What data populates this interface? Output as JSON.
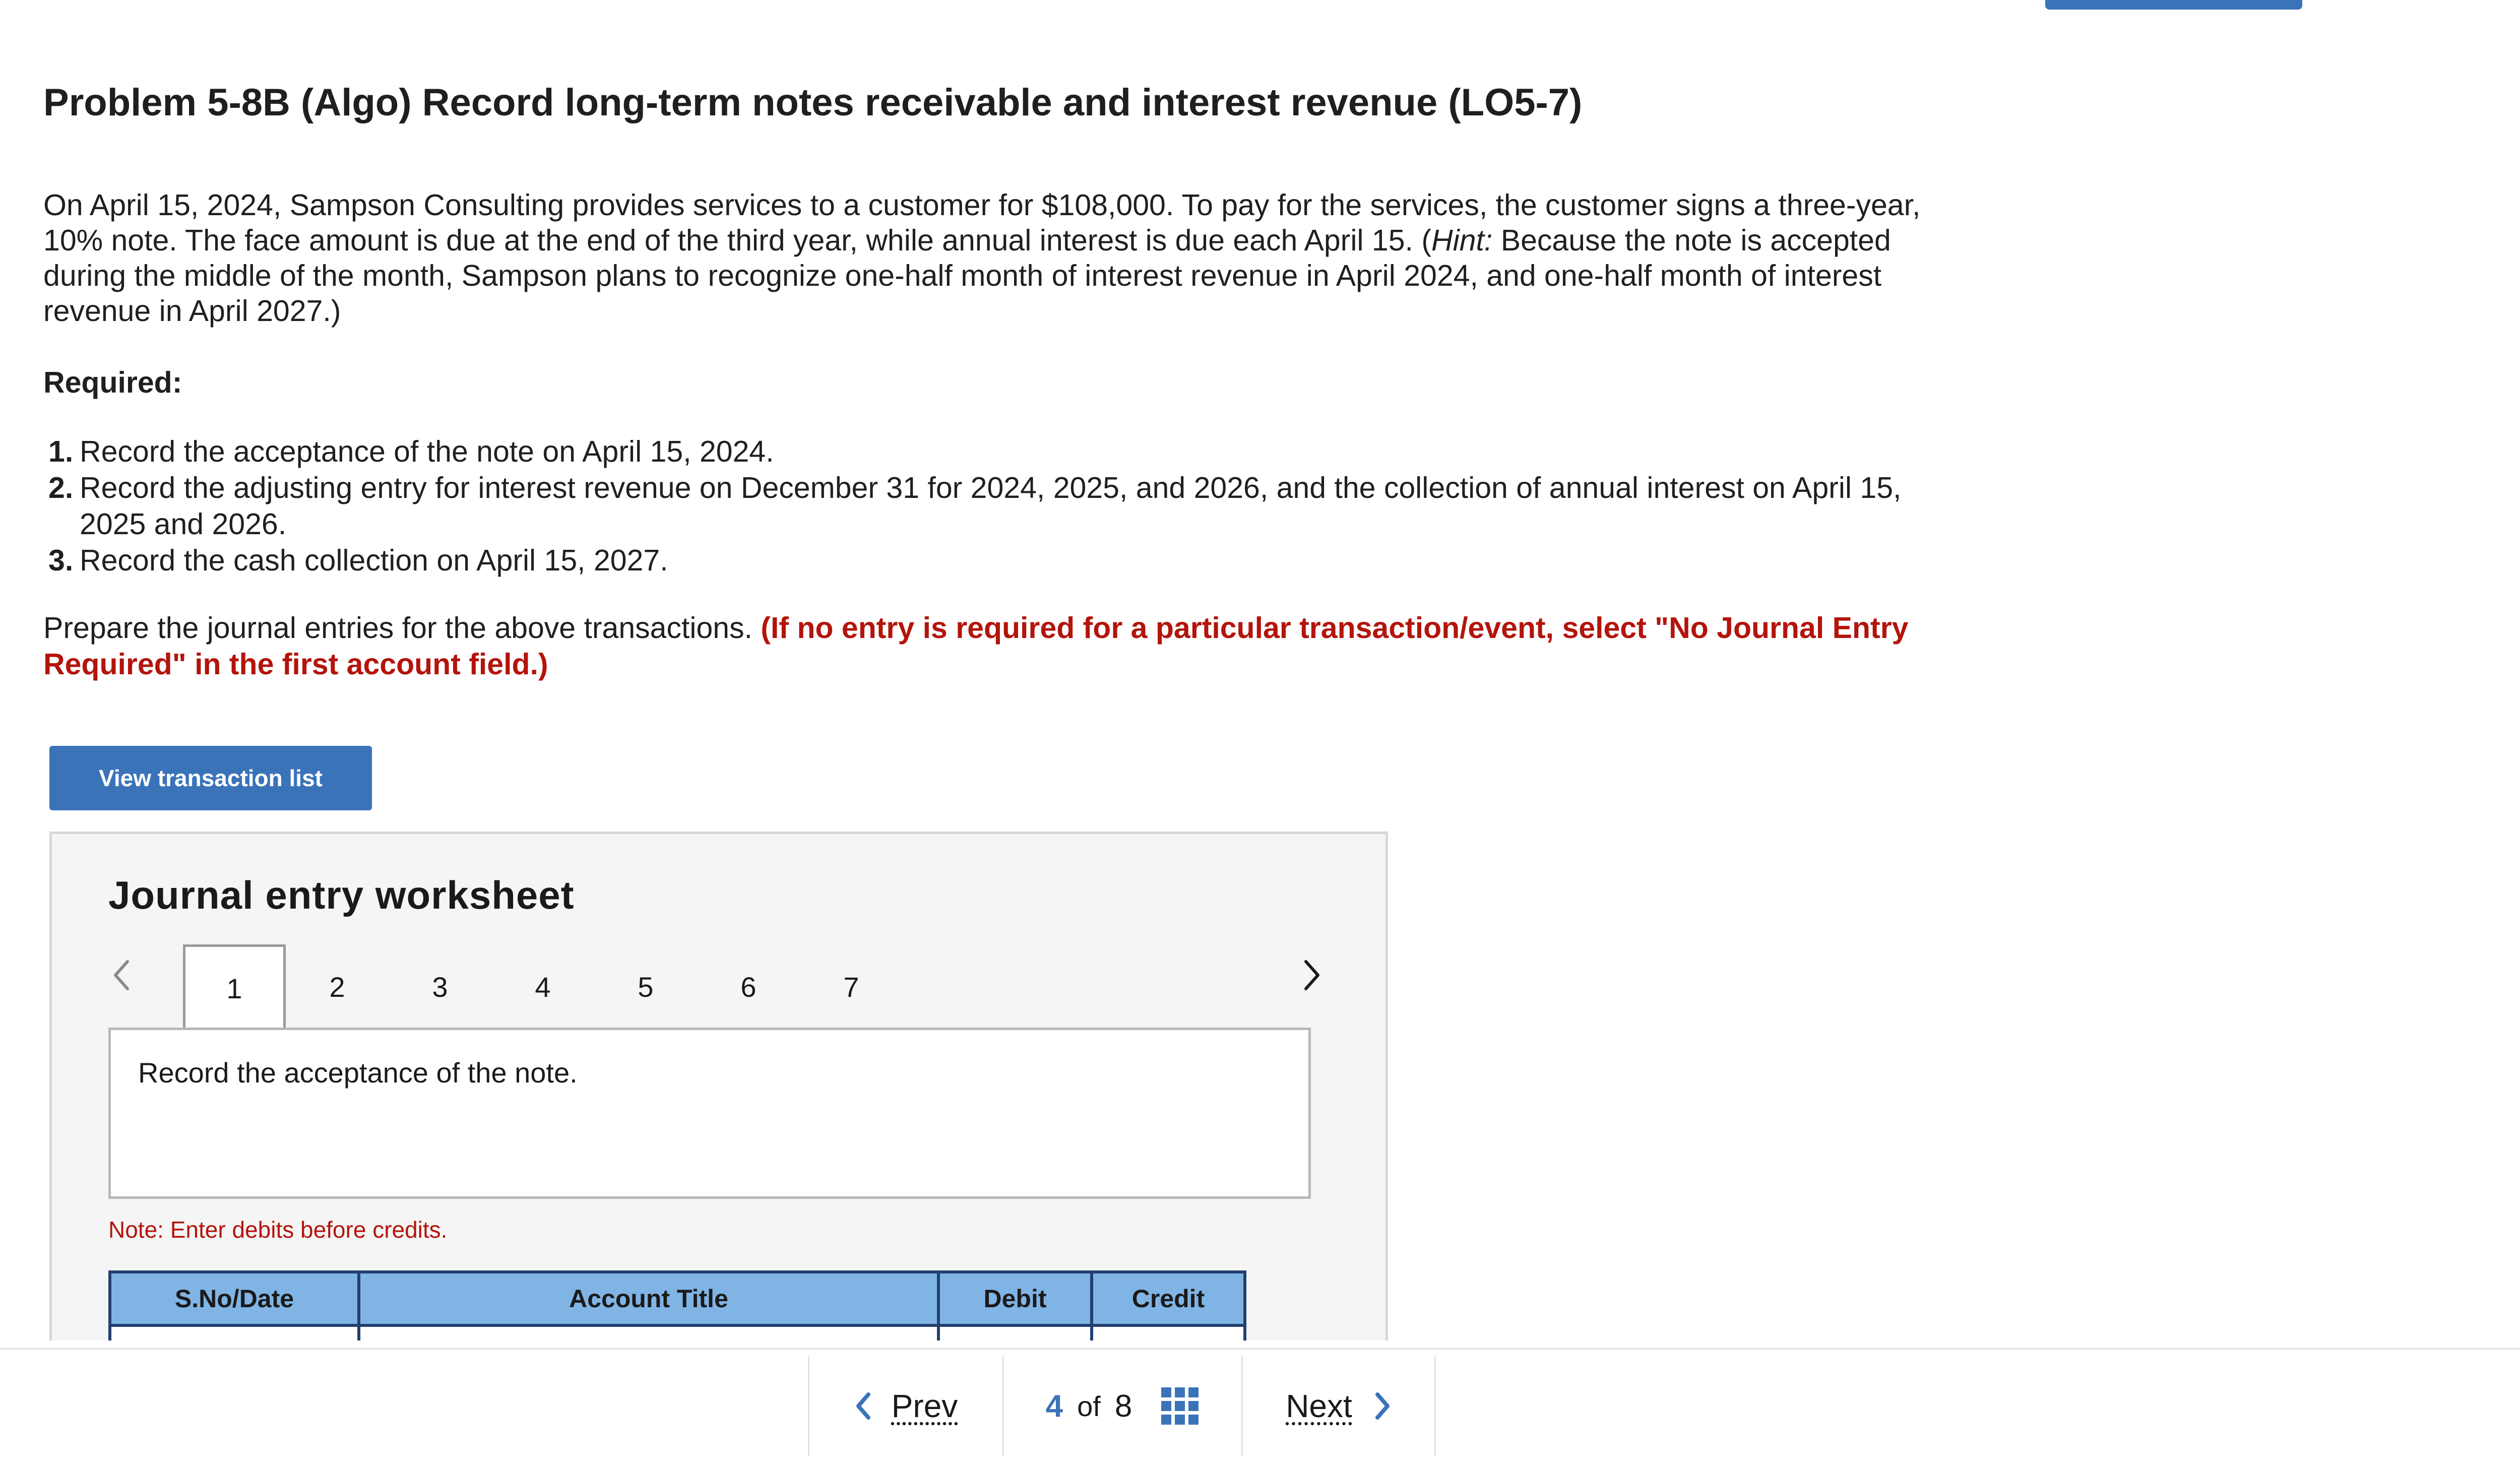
{
  "problem": {
    "title": "Problem 5-8B (Algo) Record long-term notes receivable and interest revenue (LO5-7)",
    "description_part1": "On April 15, 2024, Sampson Consulting provides services to a customer for $108,000. To pay for the services, the customer signs a three-year, 10% note. The face amount is due at the end of the third year, while annual interest is due each April 15. (",
    "description_hint_label": "Hint:",
    "description_part2": " Because the note is accepted during the middle of the month, Sampson plans to recognize one-half month of interest revenue in April 2024, and one-half month of interest revenue in April 2027.)",
    "required_label": "Required:",
    "requirements": [
      {
        "num": "1.",
        "text": "Record the acceptance of the note on April 15, 2024."
      },
      {
        "num": "2.",
        "text": "Record the adjusting entry for interest revenue on December 31 for 2024, 2025, and 2026, and the collection of annual interest on April 15, 2025 and 2026."
      },
      {
        "num": "3.",
        "text": "Record the cash collection on April 15, 2027."
      }
    ],
    "prepare_text": "Prepare the journal entries for the above transactions. ",
    "prepare_instruction": "(If no entry is required for a particular transaction/event, select \"No Journal Entry Required\" in the first account field.)"
  },
  "view_transaction_button": "View transaction list",
  "worksheet": {
    "title": "Journal entry worksheet",
    "tabs": [
      "1",
      "2",
      "3",
      "4",
      "5",
      "6",
      "7"
    ],
    "active_tab": "1",
    "instruction": "Record the acceptance of the note.",
    "note": "Note: Enter debits before credits.",
    "table_headers": [
      "S.No/Date",
      "Account Title",
      "Debit",
      "Credit"
    ]
  },
  "footer": {
    "prev_label": "Prev",
    "next_label": "Next",
    "current_page": "4",
    "of_label": "of",
    "total_pages": "8"
  },
  "colors": {
    "accent_blue": "#3b73b9",
    "instruction_red": "#b3140b",
    "table_header_bg": "#80b4e5",
    "table_border": "#23406f"
  }
}
